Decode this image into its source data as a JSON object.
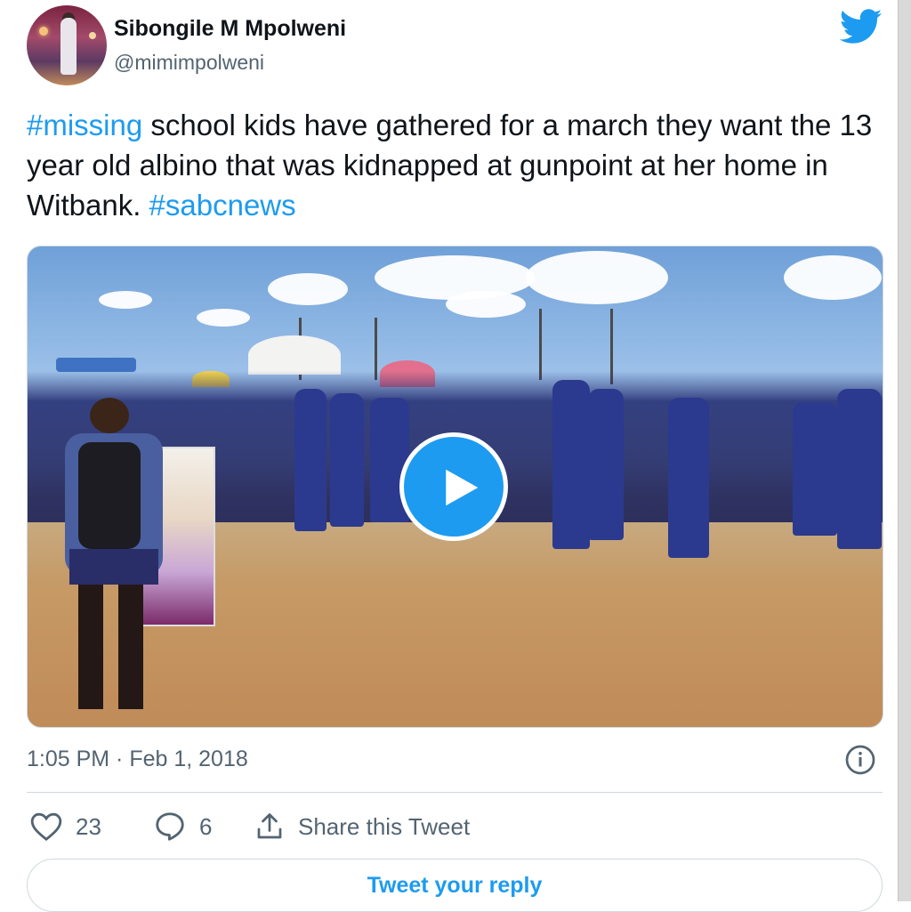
{
  "tweet": {
    "author_name": "Sibongile M Mpolweni",
    "author_handle": "@mimimpolweni",
    "text_parts": {
      "hashtag_1": "#missing",
      "body": " school kids have gathered for a march they want the 13 year old albino that was kidnapped at gunpoint at her home in Witbank. ",
      "hashtag_2": "#sabcnews"
    },
    "timestamp": "1:05 PM · Feb 1, 2018",
    "likes": "23",
    "replies": "6",
    "share_label": "Share this Tweet",
    "reply_button_label": "Tweet your reply"
  },
  "colors": {
    "accent": "#1d9bf0",
    "text": "#0f1419",
    "secondary": "#536471",
    "border": "#cfd9de"
  },
  "icons": {
    "logo": "twitter-bird-icon",
    "play": "play-icon",
    "info": "info-icon",
    "like": "heart-icon",
    "reply": "reply-bubble-icon",
    "share": "share-icon"
  }
}
